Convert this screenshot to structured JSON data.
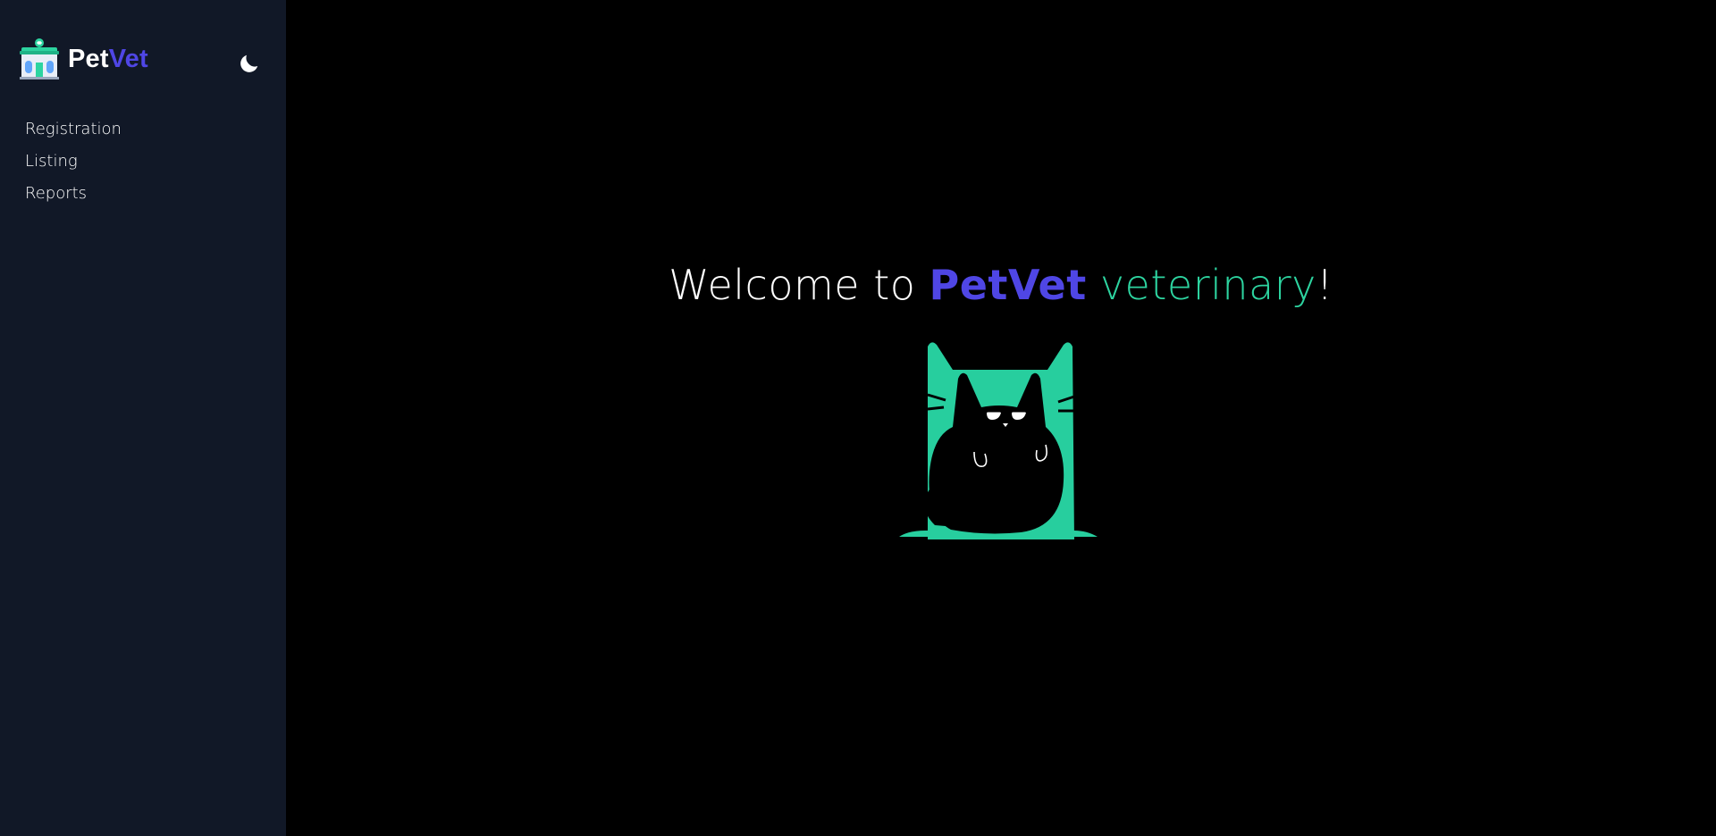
{
  "brand": {
    "name_part1": "Pet",
    "name_part2": "Vet",
    "logo_icon": "clinic-building-icon"
  },
  "theme_toggle": {
    "icon": "moon-icon"
  },
  "sidebar": {
    "items": [
      {
        "label": "Registration"
      },
      {
        "label": "Listing"
      },
      {
        "label": "Reports"
      }
    ]
  },
  "main": {
    "welcome": {
      "prefix": "Welcome to ",
      "brand": "PetVet",
      "space": " ",
      "word": "veterinary",
      "suffix": "!"
    },
    "illustration_icon": "cat-illustration"
  },
  "colors": {
    "sidebar_bg": "#111827",
    "main_bg": "#000000",
    "brand_accent": "#4f46e5",
    "green_accent": "#2dd4a0"
  }
}
